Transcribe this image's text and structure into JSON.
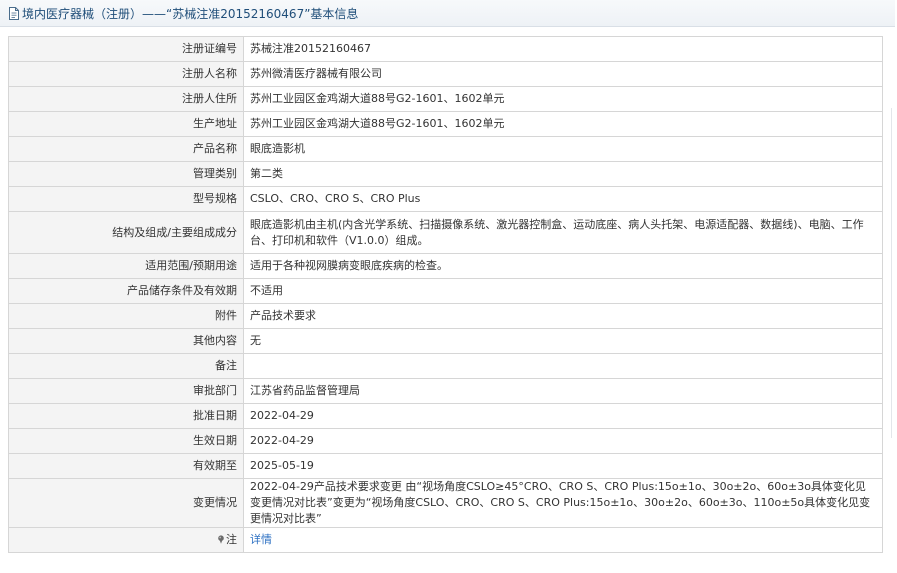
{
  "header": {
    "title": "境内医疗器械（注册）——“苏械注准20152160467”基本信息",
    "icon": "document-icon"
  },
  "rows": [
    {
      "label": "注册证编号",
      "value": "苏械注准20152160467"
    },
    {
      "label": "注册人名称",
      "value": "苏州微清医疗器械有限公司"
    },
    {
      "label": "注册人住所",
      "value": "苏州工业园区金鸡湖大道88号G2-1601、1602单元"
    },
    {
      "label": "生产地址",
      "value": "苏州工业园区金鸡湖大道88号G2-1601、1602单元"
    },
    {
      "label": "产品名称",
      "value": "眼底造影机"
    },
    {
      "label": "管理类别",
      "value": "第二类"
    },
    {
      "label": "型号规格",
      "value": "CSLO、CRO、CRO S、CRO Plus"
    },
    {
      "label": "结构及组成/主要组成成分",
      "value": "眼底造影机由主机(内含光学系统、扫描摄像系统、激光器控制盒、运动底座、病人头托架、电源适配器、数据线)、电脑、工作台、打印机和软件（V1.0.0）组成。"
    },
    {
      "label": "适用范围/预期用途",
      "value": "适用于各种视网膜病变眼底疾病的检查。"
    },
    {
      "label": "产品储存条件及有效期",
      "value": "不适用"
    },
    {
      "label": "附件",
      "value": "产品技术要求"
    },
    {
      "label": "其他内容",
      "value": "无"
    },
    {
      "label": "备注",
      "value": ""
    },
    {
      "label": "审批部门",
      "value": "江苏省药品监督管理局"
    },
    {
      "label": "批准日期",
      "value": "2022-04-29"
    },
    {
      "label": "生效日期",
      "value": "2022-04-29"
    },
    {
      "label": "有效期至",
      "value": "2025-05-19"
    },
    {
      "label": "变更情况",
      "value": "2022-04-29产品技术要求变更 由“视场角度CSLO≥45°CRO、CRO S、CRO Plus:15o±1o、30o±2o、60o±3o具体变化见变更情况对比表”变更为“视场角度CSLO、CRO、CRO S、CRO Plus:15o±1o、30o±2o、60o±3o、110o±5o具体变化见变更情况对比表”"
    }
  ],
  "note": {
    "label": "注",
    "link_text": "详情",
    "icon": "pin-icon"
  },
  "colors": {
    "title": "#1f4e79",
    "label_bg": "#f4f4f4",
    "border": "#d6d6d6",
    "link": "#2b6fc2"
  }
}
